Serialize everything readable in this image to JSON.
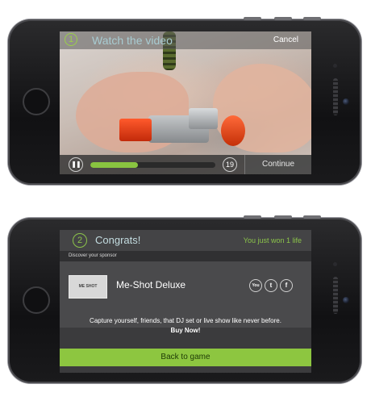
{
  "video_screen": {
    "step": "1",
    "title": "Watch the video",
    "cancel_label": "Cancel",
    "pause_icon": "pause-icon",
    "progress": 0.38,
    "countdown": "19",
    "continue_label": "Continue"
  },
  "congrats_screen": {
    "step": "2",
    "title": "Congrats!",
    "reward_text": "You just won 1 life",
    "discover_label": "Discover your sponsor",
    "sponsor_logo_text": "ME SHOT",
    "sponsor_name": "Me-Shot Deluxe",
    "social_icons": [
      "youtube-icon",
      "twitter-icon",
      "facebook-icon"
    ],
    "description": "Capture yourself, friends, that DJ set or live show like never before.",
    "cta": "Buy Now!",
    "back_label": "Back to game"
  },
  "colors": {
    "accent_green": "#8dc640",
    "title_blue": "#a8ccd2"
  }
}
